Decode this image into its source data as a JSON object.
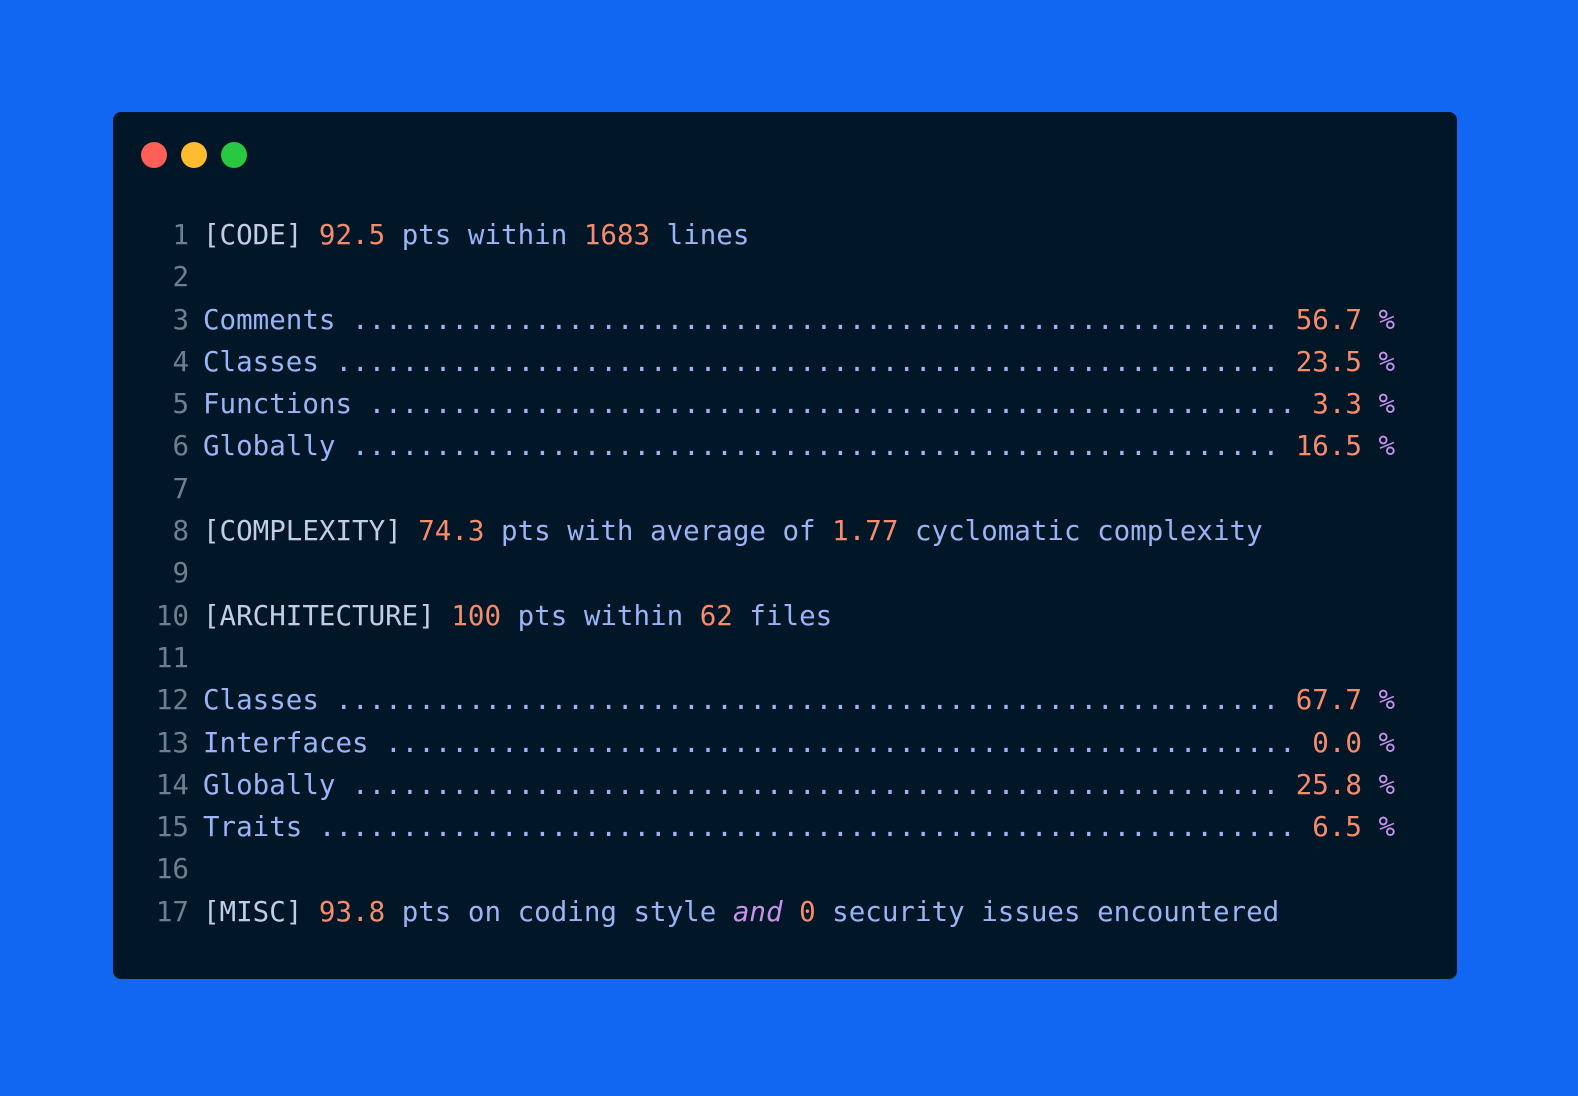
{
  "colors": {
    "background": "#1166f2",
    "window": "#011627",
    "line_number": "#6d7f93",
    "text": "#9bb4f5",
    "number": "#f78c6c",
    "percent": "#c792ea",
    "keyword": "#c792ea"
  },
  "window_controls": {
    "close": "red-dot",
    "minimize": "yellow-dot",
    "maximize": "green-dot"
  },
  "lines": [
    {
      "n": "1",
      "parts": [
        {
          "t": "[CODE]",
          "c": "tag"
        },
        {
          "t": " ",
          "c": "tx"
        },
        {
          "t": "92.5",
          "c": "num"
        },
        {
          "t": " pts within ",
          "c": "tx"
        },
        {
          "t": "1683",
          "c": "num"
        },
        {
          "t": " lines",
          "c": "tx"
        }
      ]
    },
    {
      "n": "2",
      "parts": []
    },
    {
      "n": "3",
      "parts": [
        {
          "t": "Comments ........................................................ ",
          "c": "tx"
        },
        {
          "t": "56.7",
          "c": "num"
        },
        {
          "t": " %",
          "c": "pct"
        }
      ]
    },
    {
      "n": "4",
      "parts": [
        {
          "t": "Classes ......................................................... ",
          "c": "tx"
        },
        {
          "t": "23.5",
          "c": "num"
        },
        {
          "t": " %",
          "c": "pct"
        }
      ]
    },
    {
      "n": "5",
      "parts": [
        {
          "t": "Functions ........................................................ ",
          "c": "tx"
        },
        {
          "t": "3.3",
          "c": "num"
        },
        {
          "t": " %",
          "c": "pct"
        }
      ]
    },
    {
      "n": "6",
      "parts": [
        {
          "t": "Globally ........................................................ ",
          "c": "tx"
        },
        {
          "t": "16.5",
          "c": "num"
        },
        {
          "t": " %",
          "c": "pct"
        }
      ]
    },
    {
      "n": "7",
      "parts": []
    },
    {
      "n": "8",
      "parts": [
        {
          "t": "[COMPLEXITY]",
          "c": "tag"
        },
        {
          "t": " ",
          "c": "tx"
        },
        {
          "t": "74.3",
          "c": "num"
        },
        {
          "t": " pts with average of ",
          "c": "tx"
        },
        {
          "t": "1.77",
          "c": "num"
        },
        {
          "t": " cyclomatic complexity",
          "c": "tx"
        }
      ]
    },
    {
      "n": "9",
      "parts": []
    },
    {
      "n": "10",
      "parts": [
        {
          "t": "[ARCHITECTURE]",
          "c": "tag"
        },
        {
          "t": " ",
          "c": "tx"
        },
        {
          "t": "100",
          "c": "num"
        },
        {
          "t": " pts within ",
          "c": "tx"
        },
        {
          "t": "62",
          "c": "num"
        },
        {
          "t": " files",
          "c": "tx"
        }
      ]
    },
    {
      "n": "11",
      "parts": []
    },
    {
      "n": "12",
      "parts": [
        {
          "t": "Classes ......................................................... ",
          "c": "tx"
        },
        {
          "t": "67.7",
          "c": "num"
        },
        {
          "t": " %",
          "c": "pct"
        }
      ]
    },
    {
      "n": "13",
      "parts": [
        {
          "t": "Interfaces ....................................................... ",
          "c": "tx"
        },
        {
          "t": "0.0",
          "c": "num"
        },
        {
          "t": " %",
          "c": "pct"
        }
      ]
    },
    {
      "n": "14",
      "parts": [
        {
          "t": "Globally ........................................................ ",
          "c": "tx"
        },
        {
          "t": "25.8",
          "c": "num"
        },
        {
          "t": " %",
          "c": "pct"
        }
      ]
    },
    {
      "n": "15",
      "parts": [
        {
          "t": "Traits ........................................................... ",
          "c": "tx"
        },
        {
          "t": "6.5",
          "c": "num"
        },
        {
          "t": " %",
          "c": "pct"
        }
      ]
    },
    {
      "n": "16",
      "parts": []
    },
    {
      "n": "17",
      "parts": [
        {
          "t": "[MISC]",
          "c": "tag"
        },
        {
          "t": " ",
          "c": "tx"
        },
        {
          "t": "93.8",
          "c": "num"
        },
        {
          "t": " pts on coding style ",
          "c": "tx"
        },
        {
          "t": "and",
          "c": "kw"
        },
        {
          "t": " ",
          "c": "tx"
        },
        {
          "t": "0",
          "c": "num"
        },
        {
          "t": " security issues encountered",
          "c": "tx"
        }
      ]
    }
  ]
}
